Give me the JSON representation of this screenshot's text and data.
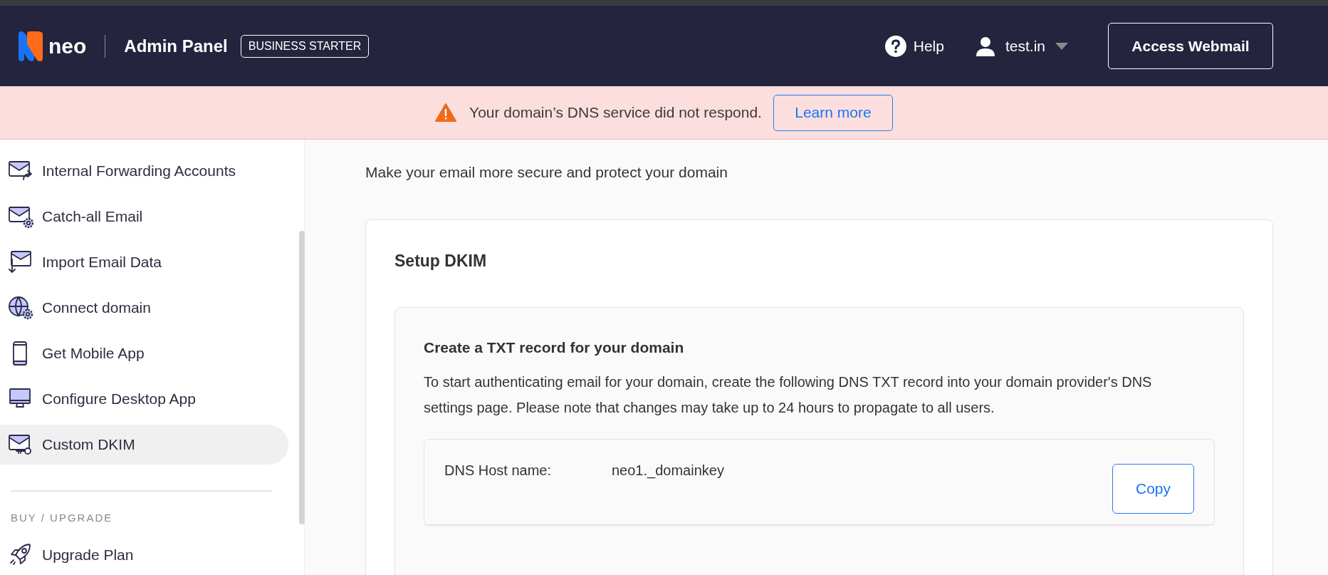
{
  "header": {
    "logo": "neo",
    "title": "Admin Panel",
    "plan_badge": "BUSINESS STARTER",
    "help": "Help",
    "account": "test.in",
    "webmail_button": "Access Webmail"
  },
  "banner": {
    "message": "Your domain’s DNS service did not respond.",
    "button": "Learn more"
  },
  "sidebar": {
    "items": [
      {
        "label": "Internal Forwarding Accounts",
        "kind": "mail-forward",
        "selected": false
      },
      {
        "label": "Catch-all Email",
        "kind": "mail-gear",
        "selected": false
      },
      {
        "label": "Import Email Data",
        "kind": "mail-import",
        "selected": false
      },
      {
        "label": "Connect domain",
        "kind": "globe-gear",
        "selected": false
      },
      {
        "label": "Get Mobile App",
        "kind": "phone",
        "selected": false
      },
      {
        "label": "Configure Desktop App",
        "kind": "monitor",
        "selected": false
      },
      {
        "label": "Custom DKIM",
        "kind": "mail-key",
        "selected": true
      }
    ],
    "section_heading": "BUY / UPGRADE",
    "section_items": [
      {
        "label": "Upgrade Plan",
        "kind": "rocket",
        "selected": false
      }
    ]
  },
  "main": {
    "subtitle": "Make your email more secure and protect your domain",
    "card": {
      "title": "Setup DKIM",
      "record_heading": "Create a TXT record for your domain",
      "record_text": "To start authenticating email for your domain, create the following DNS TXT record into your domain provider's DNS settings page. Please note that changes may take up to 24 hours to propagate to all users.",
      "rows": [
        {
          "label": "DNS Host name:",
          "value": "neo1._domainkey",
          "button": "Copy"
        }
      ]
    }
  }
}
